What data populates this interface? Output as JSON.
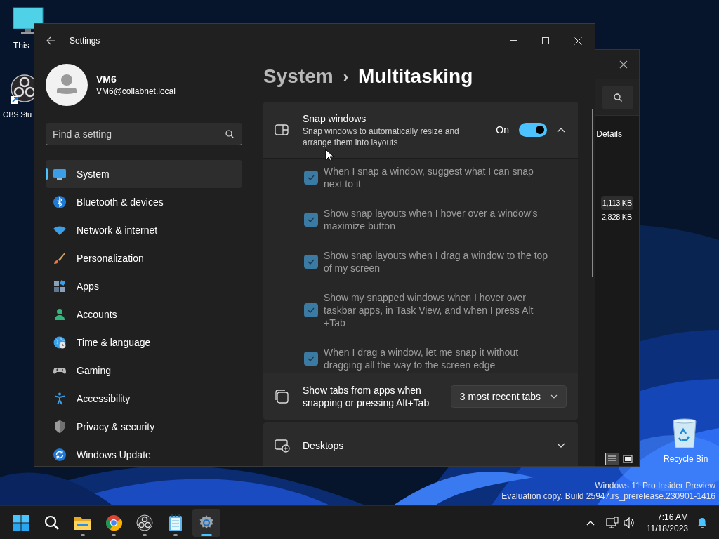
{
  "desktop": {
    "icons": [
      {
        "label": "This",
        "kind": "pc"
      },
      {
        "label": "OBS Stu",
        "kind": "obs"
      },
      {
        "label": "Recycle Bin",
        "kind": "recycle"
      }
    ],
    "watermark": [
      "Windows 11 Pro Insider Preview",
      "Evaluation copy. Build 25947.rs_prerelease.230901-1416"
    ]
  },
  "background_window": {
    "tab": "Details",
    "rows": [
      {
        "size": "1,113 KB",
        "selected": true
      },
      {
        "size": "2,828 KB",
        "selected": false
      }
    ]
  },
  "settings": {
    "title": "Settings",
    "user": {
      "name": "VM6",
      "email": "VM6@collabnet.local"
    },
    "search": {
      "placeholder": "Find a setting"
    },
    "nav": [
      {
        "label": "System",
        "kind": "system",
        "selected": true
      },
      {
        "label": "Bluetooth & devices",
        "kind": "bluetooth",
        "selected": false
      },
      {
        "label": "Network & internet",
        "kind": "network",
        "selected": false
      },
      {
        "label": "Personalization",
        "kind": "brush",
        "selected": false
      },
      {
        "label": "Apps",
        "kind": "apps",
        "selected": false
      },
      {
        "label": "Accounts",
        "kind": "accounts",
        "selected": false
      },
      {
        "label": "Time & language",
        "kind": "time",
        "selected": false
      },
      {
        "label": "Gaming",
        "kind": "gaming",
        "selected": false
      },
      {
        "label": "Accessibility",
        "kind": "accessibility",
        "selected": false
      },
      {
        "label": "Privacy & security",
        "kind": "privacy",
        "selected": false
      },
      {
        "label": "Windows Update",
        "kind": "update",
        "selected": false
      }
    ],
    "breadcrumb": {
      "parent": "System",
      "separator": "›",
      "current": "Multitasking"
    },
    "snap": {
      "title": "Snap windows",
      "description": "Snap windows to automatically resize and arrange them into layouts",
      "state_label": "On",
      "on": true,
      "expanded": true,
      "options": [
        {
          "label": "When I snap a window, suggest what I can snap next to it",
          "checked": true
        },
        {
          "label": "Show snap layouts when I hover over a window's maximize button",
          "checked": true
        },
        {
          "label": "Show snap layouts when I drag a window to the top of my screen",
          "checked": true
        },
        {
          "label": "Show my snapped windows when I hover over taskbar apps, in Task View, and when I press Alt +Tab",
          "checked": true
        },
        {
          "label": "When I drag a window, let me snap it without dragging all the way to the screen edge",
          "checked": true
        }
      ]
    },
    "tabs_setting": {
      "label": "Show tabs from apps when snapping or pressing Alt+Tab",
      "value": "3 most recent tabs"
    },
    "desktops": {
      "label": "Desktops",
      "expanded": false
    }
  },
  "taskbar": {
    "apps": [
      {
        "kind": "start",
        "running": false,
        "selected": false
      },
      {
        "kind": "search",
        "running": false,
        "selected": false
      },
      {
        "kind": "explorer",
        "running": true,
        "selected": false
      },
      {
        "kind": "chrome",
        "running": true,
        "selected": false
      },
      {
        "kind": "obs",
        "running": true,
        "selected": false
      },
      {
        "kind": "notepad",
        "running": true,
        "selected": false
      },
      {
        "kind": "settings",
        "running": true,
        "selected": true
      }
    ],
    "time": "7:16 AM",
    "date": "11/18/2023"
  }
}
